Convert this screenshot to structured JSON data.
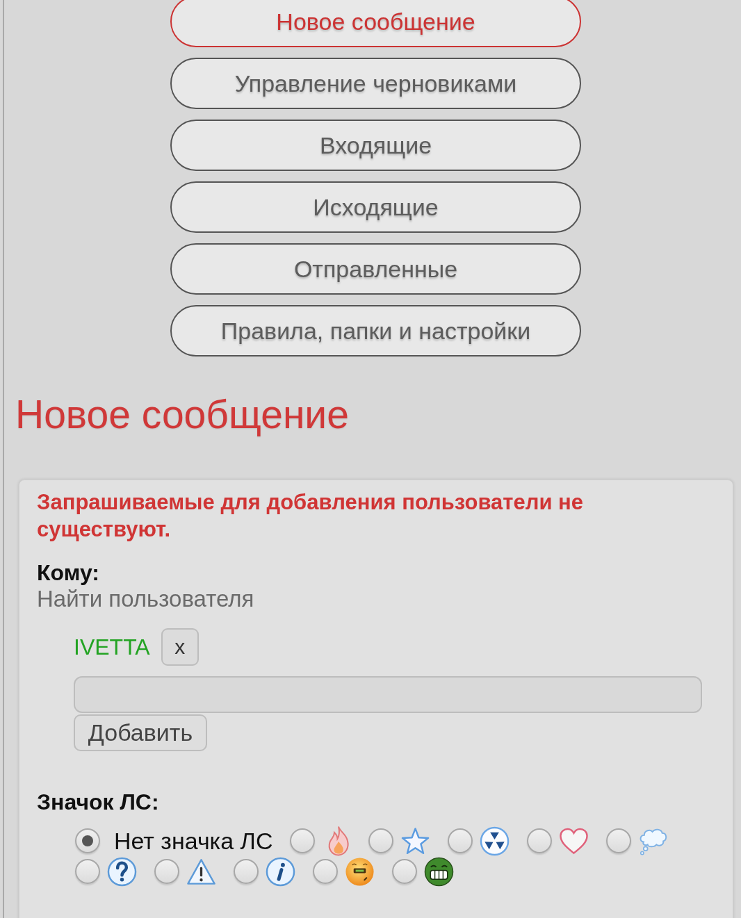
{
  "nav_buttons": [
    {
      "label": "Новое сообщение",
      "selected": true
    },
    {
      "label": "Управление черновиками",
      "selected": false
    },
    {
      "label": "Входящие",
      "selected": false
    },
    {
      "label": "Исходящие",
      "selected": false
    },
    {
      "label": "Отправленные",
      "selected": false
    },
    {
      "label": "Правила, папки и настройки",
      "selected": false
    }
  ],
  "heading": "Новое сообщение",
  "compose": {
    "error": "Запрашиваемые для добавления пользователи не существуют.",
    "to_label": "Кому:",
    "find_user": "Найти пользователя",
    "recipients": [
      {
        "name": "IVETTA",
        "remove_button": "x"
      }
    ],
    "add_button": "Добавить",
    "icon_label": "Значок ЛС:",
    "icon_options": [
      {
        "kind": "none",
        "label": "Нет значка ЛС",
        "selected": true
      },
      {
        "kind": "fire",
        "selected": false
      },
      {
        "kind": "star",
        "selected": false
      },
      {
        "kind": "radiation",
        "selected": false
      },
      {
        "kind": "heart",
        "selected": false
      },
      {
        "kind": "thought",
        "selected": false
      },
      {
        "kind": "question",
        "selected": false
      },
      {
        "kind": "warning",
        "selected": false
      },
      {
        "kind": "info",
        "selected": false
      },
      {
        "kind": "smiley",
        "selected": false
      },
      {
        "kind": "grin",
        "selected": false
      }
    ]
  }
}
